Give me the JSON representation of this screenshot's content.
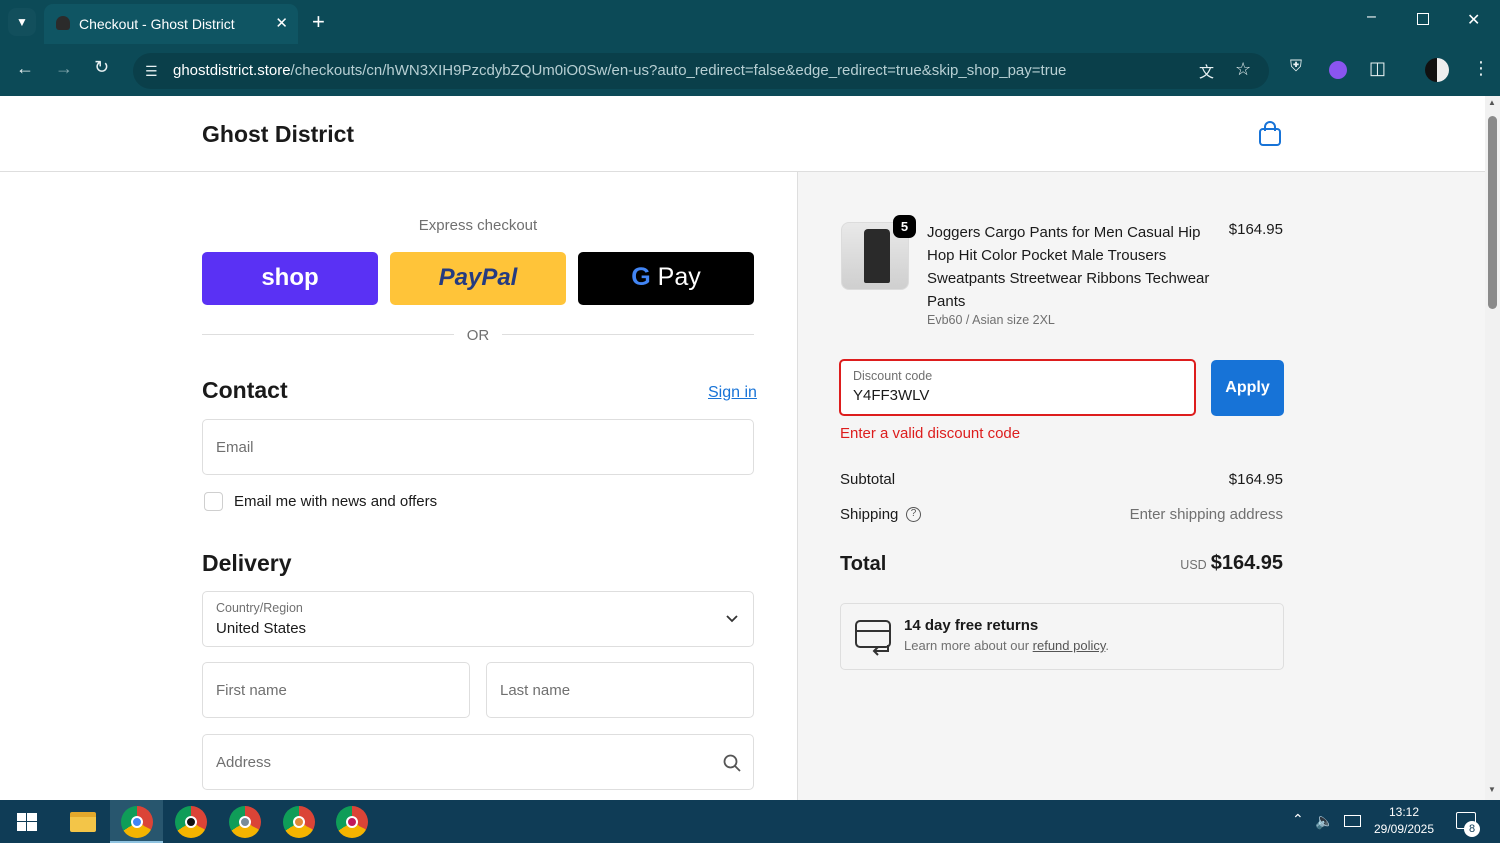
{
  "browser": {
    "tab_title": "Checkout - Ghost District",
    "url_host": "ghostdistrict.store",
    "url_path": "/checkouts/cn/hWN3XIH9PzcdybZQUm0iO0Sw/en-us?auto_redirect=false&edge_redirect=true&skip_shop_pay=true"
  },
  "store": {
    "name": "Ghost District"
  },
  "express": {
    "heading": "Express checkout",
    "shop_label": "shop",
    "paypal_label": "PayPal",
    "gpay_label": "Pay",
    "or_label": "OR"
  },
  "contact": {
    "heading": "Contact",
    "sign_in": "Sign in",
    "email_placeholder": "Email",
    "newsletter_label": "Email me with news and offers"
  },
  "delivery": {
    "heading": "Delivery",
    "country_label": "Country/Region",
    "country_value": "United States",
    "first_name_placeholder": "First name",
    "last_name_placeholder": "Last name",
    "address_placeholder": "Address"
  },
  "order": {
    "quantity": "5",
    "product_title": "Joggers Cargo Pants for Men Casual Hip Hop Hit Color Pocket Male Trousers Sweatpants Streetwear Ribbons Techwear Pants",
    "variant": "Evb60 / Asian size 2XL",
    "price": "$164.95",
    "discount_label": "Discount code",
    "discount_value": "Y4FF3WLV",
    "apply_label": "Apply",
    "discount_error": "Enter a valid discount code",
    "subtotal_label": "Subtotal",
    "subtotal_value": "$164.95",
    "shipping_label": "Shipping",
    "shipping_value": "Enter shipping address",
    "total_label": "Total",
    "currency": "USD",
    "total_value": "$164.95",
    "returns_title": "14 day free returns",
    "returns_text": "Learn more about our",
    "returns_link": "refund policy",
    "returns_period": "."
  },
  "taskbar": {
    "time": "13:12",
    "date": "29/09/2025",
    "notifications": "8"
  },
  "colors": {
    "chrome": "#0c4a57",
    "shop": "#5a31f4",
    "paypal": "#ffc439",
    "accent": "#1773d7",
    "error": "#dd1d1d"
  }
}
